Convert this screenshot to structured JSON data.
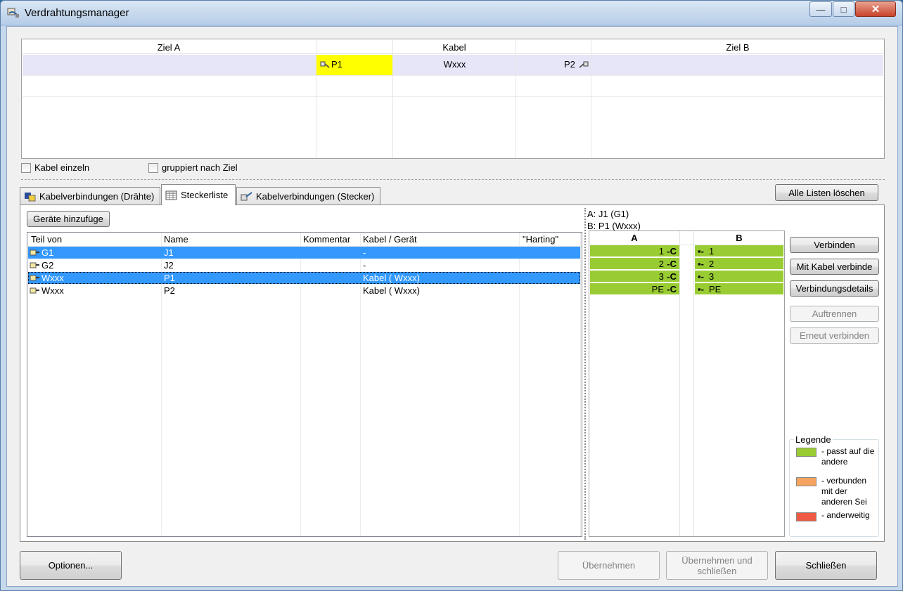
{
  "window": {
    "title": "Verdrahtungsmanager",
    "minimize": "—",
    "maximize": "□",
    "close": "✕"
  },
  "upper_grid": {
    "headers": {
      "ziel_a": "Ziel A",
      "kabel": "Kabel",
      "ziel_b": "Ziel B"
    },
    "row": {
      "end_a": "P1",
      "cable": "Wxxx",
      "end_b": "P2"
    }
  },
  "options": {
    "kabel_einzeln": "Kabel einzeln",
    "gruppiert": "gruppiert nach Ziel"
  },
  "tabs": [
    {
      "label": "Kabelverbindungen (Drähte)"
    },
    {
      "label": "Steckerliste"
    },
    {
      "label": "Kabelverbindungen (Stecker)"
    }
  ],
  "clear_lists_button": "Alle Listen löschen",
  "add_devices_button": "Geräte hinzufüge",
  "plug_list": {
    "columns": [
      "Teil von",
      "Name",
      "Kommentar",
      "Kabel / Gerät",
      "\"Harting\""
    ],
    "rows": [
      {
        "part_of": "G1",
        "name": "J1",
        "comment": "",
        "cable": "-",
        "harting": "",
        "selected": true
      },
      {
        "part_of": "G2",
        "name": "J2",
        "comment": "",
        "cable": "-",
        "harting": "",
        "selected": false
      },
      {
        "part_of": "Wxxx",
        "name": "P1",
        "comment": "",
        "cable": "Kabel ( Wxxx)",
        "harting": "",
        "selected": true
      },
      {
        "part_of": "Wxxx",
        "name": "P2",
        "comment": "",
        "cable": "Kabel ( Wxxx)",
        "harting": "",
        "selected": false
      }
    ]
  },
  "connection": {
    "side_a": "A: J1 (G1)",
    "side_b": "B: P1 (Wxxx)",
    "col_a": "A",
    "col_b": "B",
    "pins": [
      {
        "a": "1",
        "b": "1"
      },
      {
        "a": "2",
        "b": "2"
      },
      {
        "a": "3",
        "b": "3"
      },
      {
        "a": "PE",
        "b": "PE"
      }
    ],
    "pin_match_color": "#99cc33"
  },
  "actions": {
    "verbinden": "Verbinden",
    "mit_kabel": "Mit Kabel verbinde",
    "details": "Verbindungsdetails",
    "auftrennen": "Auftrennen",
    "erneut": "Erneut verbinden"
  },
  "legend": {
    "title": "Legende",
    "items": [
      {
        "text": "- passt auf die andere",
        "color": "#99cc33"
      },
      {
        "text": "- verbunden mit der anderen Sei",
        "color": "#f4a460"
      },
      {
        "text": "- anderweitig",
        "color": "#ee5a44"
      }
    ]
  },
  "footer": {
    "options": "Optionen...",
    "apply": "Übernehmen",
    "apply_close": "Übernehmen und schließen",
    "close": "Schließen"
  }
}
